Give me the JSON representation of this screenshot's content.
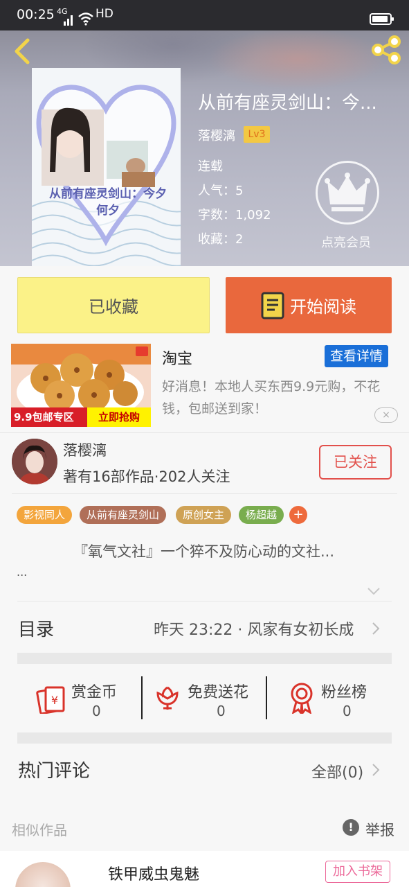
{
  "status_bar": {
    "time": "00:25",
    "network": "4G",
    "quality": "HD"
  },
  "book": {
    "cover_text": "从前有座灵剑山：今夕何夕",
    "title": "从前有座灵剑山：今...",
    "author": "落樱漓",
    "level": "Lv3",
    "status": "连载",
    "popularity": "人气：5",
    "word_count": "字数：1,092",
    "favorites": "收藏：2"
  },
  "vip": {
    "label": "点亮会员"
  },
  "actions": {
    "collected": "已收藏",
    "start_reading": "开始阅读"
  },
  "ad": {
    "brand": "淘宝",
    "detail_button": "查看详情",
    "description": "好消息！本地人买东西9.9元购，不花钱，包邮送到家！",
    "promo_left": "9.9包邮专区",
    "promo_right": "立即抢购",
    "close": "×"
  },
  "author_section": {
    "name": "落樱漓",
    "stats": "著有16部作品·202人关注",
    "follow_button": "已关注"
  },
  "tags": [
    {
      "label": "影视同人",
      "color": "#f3a53c"
    },
    {
      "label": "从前有座灵剑山",
      "color": "#b06f58"
    },
    {
      "label": "原创女主",
      "color": "#cfa255"
    },
    {
      "label": "杨超越",
      "color": "#79ad4e"
    }
  ],
  "tag_more": "+",
  "synopsis": {
    "text": "『氧气文社』一个猝不及防心动的文社...",
    "more": "..."
  },
  "toc": {
    "label": "目录",
    "latest": "昨天 23:22 · 风家有女初长成"
  },
  "rewards": [
    {
      "label": "赏金币",
      "count": "0",
      "icon": "red-envelope-icon"
    },
    {
      "label": "免费送花",
      "count": "0",
      "icon": "flower-icon"
    },
    {
      "label": "粉丝榜",
      "count": "0",
      "icon": "medal-icon"
    }
  ],
  "comments": {
    "label": "热门评论",
    "all": "全部(0)"
  },
  "similar": {
    "label": "相似作品",
    "report": "举报",
    "item_title": "铁甲威虫鬼魅",
    "add_to_shelf": "加入书架"
  },
  "colors": {
    "accent_orange": "#e9683d",
    "collected_yellow": "#fbf288",
    "follow_red": "#e2504b",
    "detail_blue": "#1a6fd8"
  }
}
